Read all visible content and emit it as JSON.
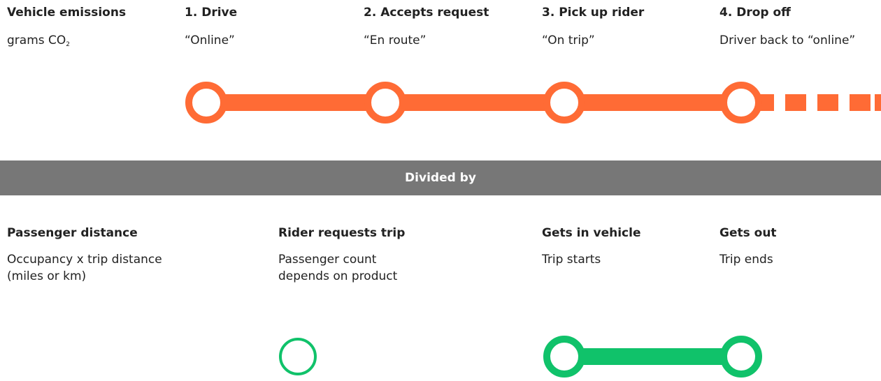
{
  "colors": {
    "emissions": "#FF6B35",
    "distance": "#10C26A",
    "divider_bg": "#777777"
  },
  "emissions": {
    "title": "Vehicle emissions",
    "unit_prefix": "grams CO",
    "unit_sub": "2",
    "stages": [
      {
        "title": "1. Drive",
        "subtitle": "“Online”"
      },
      {
        "title": "2. Accepts request",
        "subtitle": "“En route”"
      },
      {
        "title": "3. Pick up rider",
        "subtitle": "“On trip”"
      },
      {
        "title": "4. Drop off",
        "subtitle": "Driver back to “online”"
      }
    ]
  },
  "divider": {
    "label": "Divided by"
  },
  "distance": {
    "title": "Passenger distance",
    "description": "Occupancy x trip distance (miles or km)",
    "stages": [
      {
        "title": "Rider requests trip",
        "subtitle": "Passenger count depends on product"
      },
      {
        "title": "Gets in vehicle",
        "subtitle": "Trip starts"
      },
      {
        "title": "Gets out",
        "subtitle": "Trip ends"
      }
    ]
  }
}
